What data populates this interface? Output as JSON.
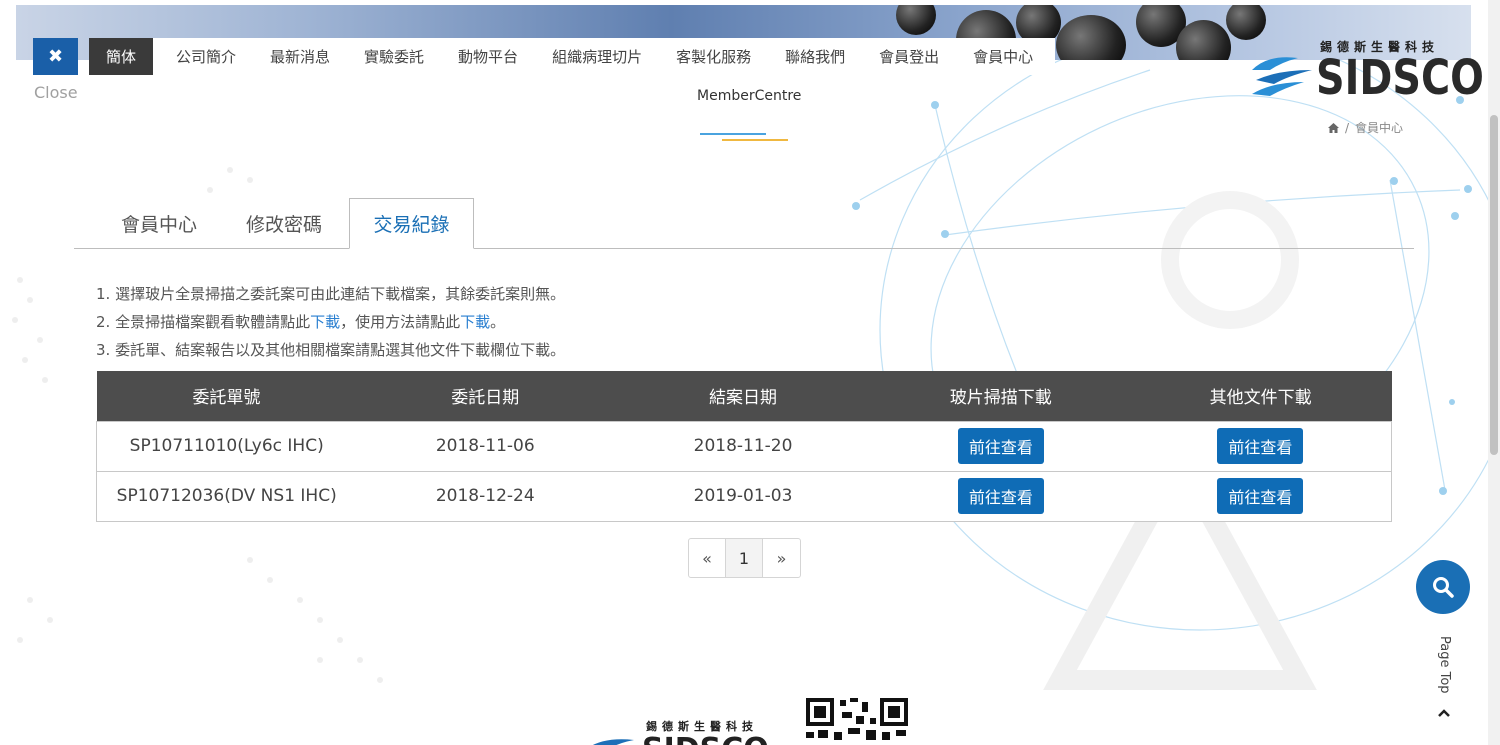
{
  "close": {
    "icon": "close-icon",
    "label": "Close"
  },
  "nav": {
    "lang": "簡体",
    "items": [
      "公司簡介",
      "最新消息",
      "實驗委託",
      "動物平台",
      "組織病理切片",
      "客製化服務",
      "聯絡我們",
      "會員登出",
      "會員中心"
    ]
  },
  "logo": {
    "cn": "錫德斯生醫科技",
    "en": "SIDSCO"
  },
  "page": {
    "subtitle": "MemberCentre"
  },
  "breadcrumb": {
    "icon": "home-icon",
    "current": "會員中心"
  },
  "tabs": [
    "會員中心",
    "修改密碼",
    "交易紀錄"
  ],
  "notes": {
    "line1": "1. 選擇玻片全景掃描之委託案可由此連結下載檔案，其餘委託案則無。",
    "line2_a": "2. 全景掃描檔案觀看軟體請點此",
    "line2_link1": "下載",
    "line2_b": "，使用方法請點此",
    "line2_link2": "下載",
    "line2_c": "。",
    "line3": "3. 委託單、結案報告以及其他相關檔案請點選其他文件下載欄位下載。"
  },
  "table": {
    "headers": [
      "委託單號",
      "委託日期",
      "結案日期",
      "玻片掃描下載",
      "其他文件下載"
    ],
    "rows": [
      {
        "order": "SP10711010(Ly6c IHC)",
        "date": "2018-11-06",
        "closed": "2018-11-20",
        "slide_btn": "前往查看",
        "docs_btn": "前往查看"
      },
      {
        "order": "SP10712036(DV NS1 IHC)",
        "date": "2018-12-24",
        "closed": "2019-01-03",
        "slide_btn": "前往查看",
        "docs_btn": "前往查看"
      }
    ]
  },
  "pager": {
    "prev": "«",
    "current": "1",
    "next": "»"
  },
  "floating": {
    "search_icon": "search-icon",
    "page_top": "Page Top",
    "page_top_icon": "chevron-up-icon"
  },
  "footer": {
    "cn": "錫德斯生醫科技",
    "en": "SIDSCO"
  },
  "colors": {
    "brand_blue": "#1a6fb5",
    "table_header": "#4d4d4d",
    "nav_active": "#3a3a3a",
    "link": "#2a7fd0"
  }
}
